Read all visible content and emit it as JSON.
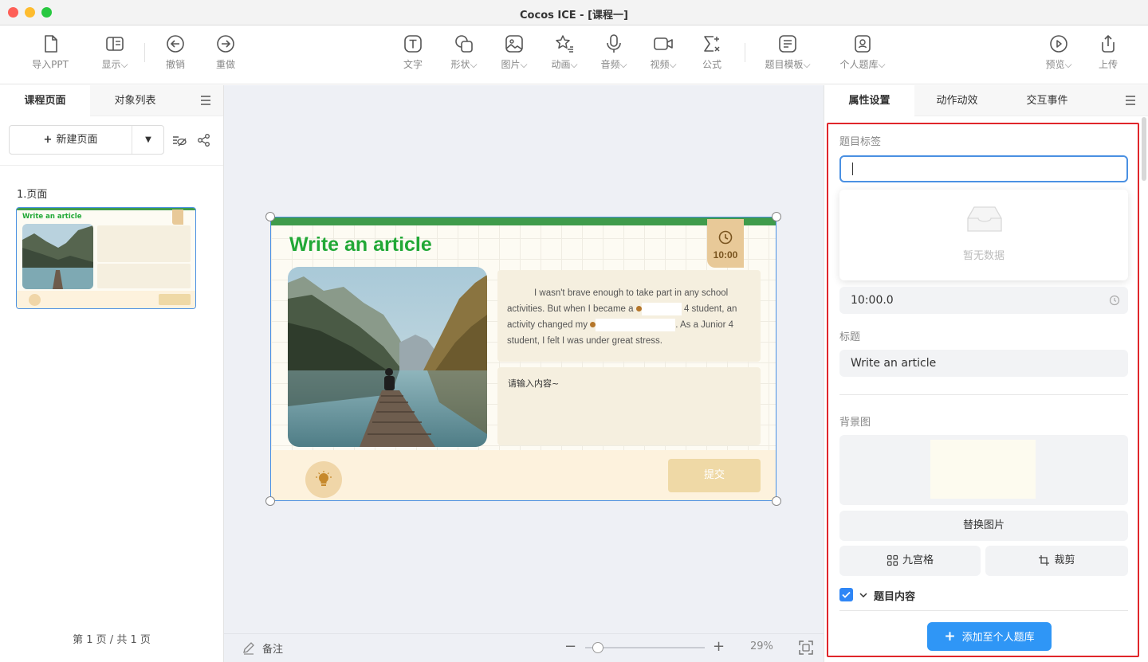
{
  "window": {
    "title": "Cocos ICE - [课程一]"
  },
  "toolbar": {
    "import_ppt": "导入PPT",
    "display": "显示",
    "undo": "撤销",
    "redo": "重做",
    "text": "文字",
    "shape": "形状",
    "image": "图片",
    "animation": "动画",
    "audio": "音频",
    "video": "视频",
    "formula": "公式",
    "question_template": "题目模板",
    "personal_bank": "个人题库",
    "preview": "预览",
    "upload": "上传"
  },
  "left_panel": {
    "tabs": [
      "课程页面",
      "对象列表"
    ],
    "new_page": "新建页面",
    "page_label": "1.页面",
    "footer": "第 1 页 / 共 1 页",
    "thumb_title": "Write an article"
  },
  "slide": {
    "title": "Write an article",
    "timer": "10:00",
    "text_part1": "I wasn't brave enough to take part in any school activities. But when I became a",
    "text_part2": "4 student, an activity changed my",
    "text_part3": ". As a Junior 4 student, I felt I was under great stress.",
    "input_placeholder": "请输入内容~",
    "submit": "提交"
  },
  "canvas_footer": {
    "notes": "备注",
    "zoom": "29%",
    "zoom_level": 0.29
  },
  "right_panel": {
    "tabs": [
      "属性设置",
      "动作动效",
      "交互事件"
    ],
    "tag_label": "题目标签",
    "tag_value": "",
    "no_data": "暂无数据",
    "time_value": "10:00.0",
    "title_label": "标题",
    "title_value": "Write an article",
    "bg_label": "背景图",
    "replace_image": "替换图片",
    "nine_grid": "九宫格",
    "crop": "裁剪",
    "content_label": "题目内容",
    "add_to_bank": "添加至个人题库"
  },
  "colors": {
    "accent": "#2f96f6",
    "title_green": "#21a836",
    "highlight": "#e0262b"
  }
}
